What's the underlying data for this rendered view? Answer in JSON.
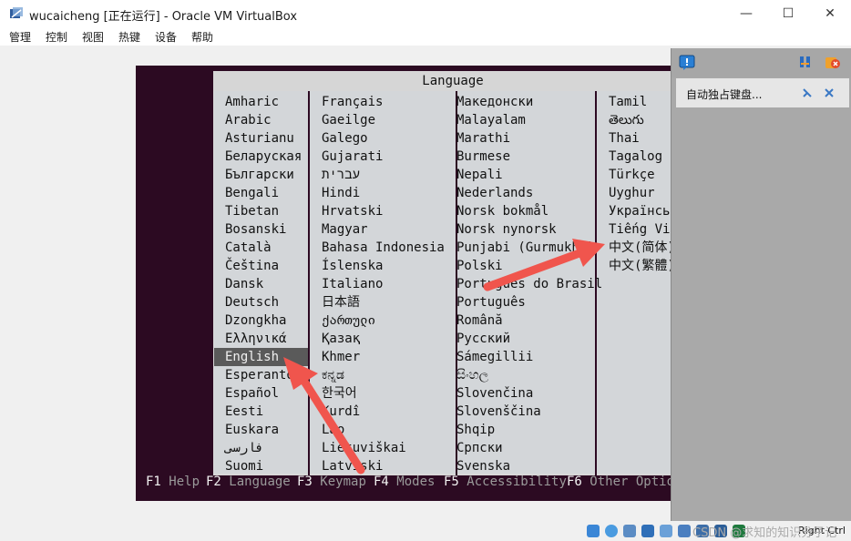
{
  "window": {
    "title": "wucaicheng [正在运行] - Oracle VM VirtualBox",
    "minimize": "—",
    "maximize": "☐",
    "close": "✕"
  },
  "menu": [
    "管理",
    "控制",
    "视图",
    "热键",
    "设备",
    "帮助"
  ],
  "dialog": {
    "title": "Language",
    "columns": [
      [
        "Amharic",
        "Arabic",
        "Asturianu",
        "Беларуская",
        "Български",
        "Bengali",
        "Tibetan",
        "Bosanski",
        "Català",
        "Čeština",
        "Dansk",
        "Deutsch",
        "Dzongkha",
        "Ελληνικά",
        "English",
        "Esperanto",
        "Español",
        "Eesti",
        "Euskara",
        "فارسی",
        "Suomi"
      ],
      [
        "Français",
        "Gaeilge",
        "Galego",
        "Gujarati",
        "עברית",
        "Hindi",
        "Hrvatski",
        "Magyar",
        "Bahasa Indonesia",
        "Íslenska",
        "Italiano",
        "日本語",
        "ქართული",
        "Қазақ",
        "Khmer",
        "ಕನ್ನಡ",
        "한국어",
        "Kurdî",
        "Lao",
        "Lietuviškai",
        "Latviski"
      ],
      [
        "Македонски",
        "Malayalam",
        "Marathi",
        "Burmese",
        "Nepali",
        "Nederlands",
        "Norsk bokmål",
        "Norsk nynorsk",
        "Punjabi (Gurmukhi)",
        "Polski",
        "Português do Brasil",
        "Português",
        "Română",
        "Русский",
        "Sámegillii",
        "සිංහල",
        "Slovenčina",
        "Slovenščina",
        "Shqip",
        "Српски",
        "Svenska"
      ],
      [
        "Tamil",
        "తెలుగు",
        "Thai",
        "Tagalog",
        "Türkçe",
        "Uyghur",
        "Українська",
        "Tiếng Việt",
        "中文(简体)",
        "中文(繁體)"
      ]
    ],
    "selected": "English"
  },
  "fkeys": [
    {
      "key": "F1",
      "label": "Help"
    },
    {
      "key": "F2",
      "label": "Language"
    },
    {
      "key": "F3",
      "label": "Keymap"
    },
    {
      "key": "F4",
      "label": "Modes"
    },
    {
      "key": "F5",
      "label": "Accessibility"
    },
    {
      "key": "F6",
      "label": "Other Options"
    }
  ],
  "notification": {
    "text": "自动独占键盘..."
  },
  "status": {
    "host_key": "Right Ctrl",
    "watermark": "CSDN @求知的知识分子记"
  },
  "colors": {
    "screen_bg": "#2c0a22",
    "dialog_bg": "#d3d6d9",
    "selected_bg": "#5a5a5a",
    "arrow": "#f0554d"
  },
  "icons": [
    "virtualbox-icon",
    "message-icon",
    "pin-icon",
    "close-all-icon",
    "dismiss-icon",
    "disk-icon",
    "network-icon",
    "usb-icon",
    "shared-folder-icon",
    "display-icon",
    "recording-icon",
    "cpu-icon",
    "mouse-icon",
    "keyboard-icon"
  ]
}
